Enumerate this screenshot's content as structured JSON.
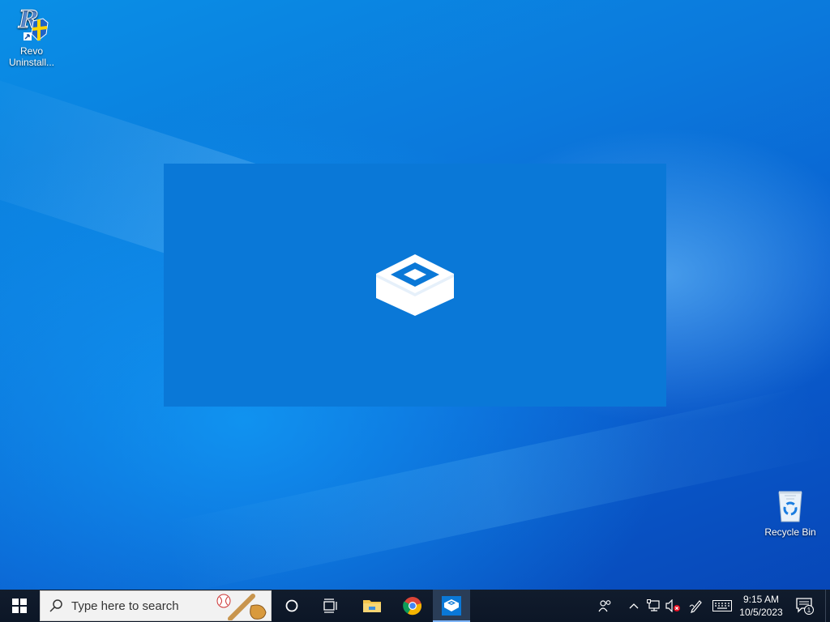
{
  "desktop": {
    "icons": [
      {
        "label": "Revo\nUninstall...",
        "line1": "Revo",
        "line2": "Uninstall..."
      },
      {
        "label": "Recycle Bin"
      }
    ]
  },
  "taskbar": {
    "search_placeholder": "Type here to search",
    "apps": [
      "start",
      "cortana",
      "task-view",
      "file-explorer",
      "google-chrome",
      "windows-sandbox"
    ],
    "clock": {
      "time": "9:15 AM",
      "date": "10/5/2023"
    },
    "notification_count": "1"
  },
  "colors": {
    "splash_bg": "#0a78d7",
    "taskbar_bg": "#111c2d",
    "accent": "#0a78d7"
  }
}
